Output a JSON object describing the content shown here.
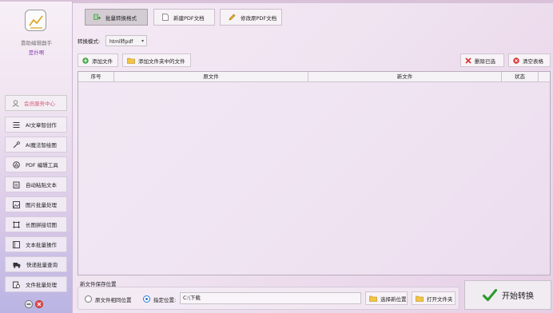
{
  "sidebar": {
    "app_name": "靠助编辑器手",
    "app_sub": "是扑啊",
    "member_label": "会员服务中心",
    "items": [
      {
        "label": "AI文章智创作",
        "icon": "list-lines-icon"
      },
      {
        "label": "AI魔法智绘图",
        "icon": "magic-wand-icon"
      },
      {
        "label": "PDF 编辑工具",
        "icon": "pdf-tool-icon"
      },
      {
        "label": "自动粘贴文本",
        "icon": "clipboard-icon"
      },
      {
        "label": "图片批量处理",
        "icon": "image-icon"
      },
      {
        "label": "长图拼接切图",
        "icon": "crop-icon"
      },
      {
        "label": "文本批量操作",
        "icon": "text-doc-icon"
      },
      {
        "label": "快递批量查询",
        "icon": "truck-icon"
      },
      {
        "label": "文件批量处理",
        "icon": "file-process-icon"
      }
    ]
  },
  "tabs": [
    {
      "label": "批量转换格式",
      "active": true
    },
    {
      "label": "新建PDF文档",
      "active": false
    },
    {
      "label": "修改原PDF文档",
      "active": false
    }
  ],
  "mode": {
    "label": "转换模式:",
    "value": "html转pdf"
  },
  "actions": {
    "add_file": "添加文件",
    "add_folder": "添加文件夹中的文件",
    "delete_selected": "删除已选",
    "clear_table": "清空表格"
  },
  "table": {
    "columns": [
      "序号",
      "原文件",
      "新文件",
      "状态"
    ]
  },
  "save": {
    "title": "新文件保存位置",
    "option_same": "原文件相同位置",
    "option_custom": "指定位置:",
    "path": "C:\\下载",
    "choose_btn": "选择新位置",
    "open_btn": "打开文件夹"
  },
  "start_label": "开始转换",
  "colors": {
    "accent_purple": "#8a3fb3",
    "member_text": "#d45b78",
    "check_green": "#2e9b2e"
  }
}
